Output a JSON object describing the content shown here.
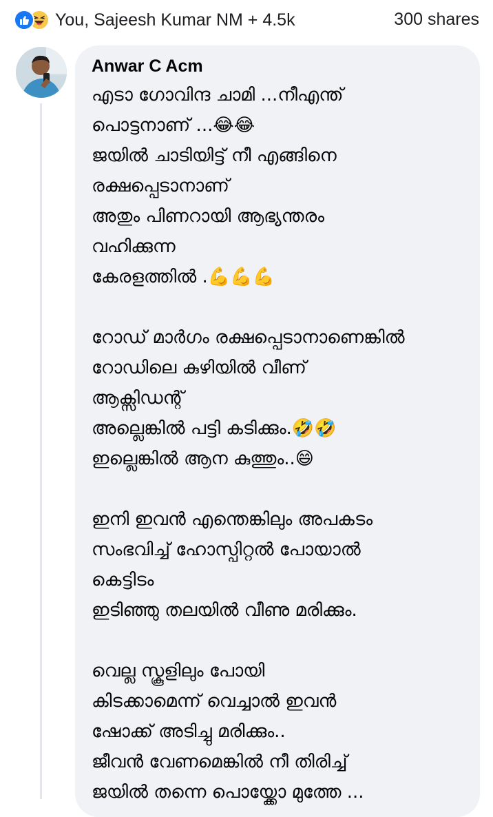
{
  "reactions": {
    "icons": [
      "like-icon",
      "haha-icon"
    ],
    "summary": "You, Sajeesh Kumar NM + 4.5k",
    "shares": "300 shares"
  },
  "comment": {
    "author": "Anwar C Acm",
    "paragraphs": [
      [
        "എടാ ഗോവിന്ദ ചാമി ...നീഎന്ത്",
        "പൊട്ടനാണ് ...😂😂",
        "ജയിൽ ചാടിയിട്ട് നീ എങ്ങിനെ",
        "രക്ഷപ്പെടാനാണ്",
        "അതും പിണറായി ആഭ്യന്തരം",
        "വഹിക്കുന്ന",
        "കേരളത്തിൽ .💪💪💪"
      ],
      [
        "റോഡ് മാർഗം രക്ഷപ്പെടാനാണെങ്കിൽ",
        "റോഡിലെ കുഴിയിൽ വീണ്",
        "ആക്സിഡന്റ്",
        "അല്ലെങ്കിൽ പട്ടി കടിക്കും.🤣🤣",
        "ഇല്ലെങ്കിൽ ആന കുത്തും..😄"
      ],
      [
        "ഇനി ഇവൻ എന്തെങ്കിലും അപകടം",
        "സംഭവിച്ച് ഹോസ്പിറ്റൽ പോയാൽ",
        "കെട്ടിടം",
        "ഇടിഞ്ഞു തലയിൽ വീണു മരിക്കും."
      ],
      [
        "വെല്ല സ്കൂളിലും പോയി",
        "കിടക്കാമെന്ന് വെച്ചാൽ ഇവൻ",
        "ഷോക്ക് അടിച്ചു മരിക്കും..",
        "ജീവൻ വേണമെങ്കിൽ നീ തിരിച്ച്",
        "ജയിൽ തന്നെ പൊയ്ക്കോ മുത്തേ ..."
      ]
    ]
  },
  "colors": {
    "like": "#1877f2",
    "haha": "#f7c84b",
    "bubble": "#f0f2f5",
    "text": "#050505"
  }
}
